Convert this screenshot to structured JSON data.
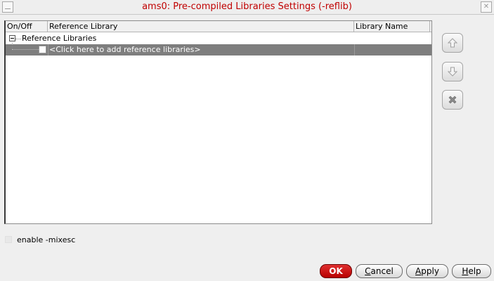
{
  "window": {
    "title": "ams0: Pre-compiled Libraries Settings (-reflib)",
    "close_glyph": "✕"
  },
  "table": {
    "columns": [
      "On/Off",
      "Reference Library",
      "Library Name"
    ],
    "root_label": "Reference Libraries",
    "add_row_label": "<Click here to add reference libraries>",
    "add_row_checked": false,
    "selected_row_color": "#7e7e7e"
  },
  "side_buttons": {
    "move_up_icon": "arrow-up-icon",
    "move_down_icon": "arrow-down-icon",
    "delete_icon": "delete-x-icon"
  },
  "options": {
    "mixesc_label": "enable -mixesc",
    "mixesc_checked": false
  },
  "buttons": {
    "ok": "OK",
    "cancel_mnemonic": "C",
    "cancel_rest": "ancel",
    "apply_mnemonic": "A",
    "apply_rest": "pply",
    "help_mnemonic": "H",
    "help_rest": "elp"
  },
  "colors": {
    "title_text": "#c00000",
    "ok_button": "#c80000"
  }
}
